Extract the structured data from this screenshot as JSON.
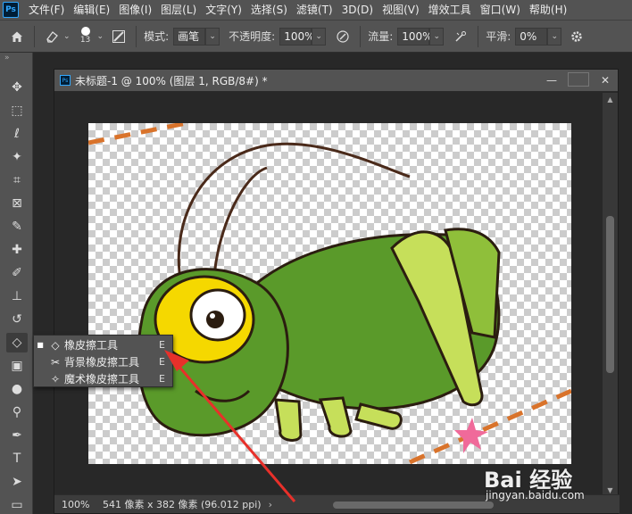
{
  "menubar": {
    "logo": "Ps",
    "items": [
      "文件(F)",
      "编辑(E)",
      "图像(I)",
      "图层(L)",
      "文字(Y)",
      "选择(S)",
      "滤镜(T)",
      "3D(D)",
      "视图(V)",
      "增效工具",
      "窗口(W)",
      "帮助(H)"
    ]
  },
  "options": {
    "brush_size": "13",
    "mode_label": "模式:",
    "mode_value": "画笔",
    "opacity_label": "不透明度:",
    "opacity_value": "100%",
    "flow_label": "流量:",
    "flow_value": "100%",
    "smooth_label": "平滑:",
    "smooth_value": "0%"
  },
  "toolbar": {
    "collapse": "»",
    "tools": [
      {
        "name": "move-tool",
        "glyph": "✥"
      },
      {
        "name": "marquee-tool",
        "glyph": "⬚"
      },
      {
        "name": "lasso-tool",
        "glyph": "ℓ"
      },
      {
        "name": "magic-wand-tool",
        "glyph": "✦"
      },
      {
        "name": "crop-tool",
        "glyph": "⌗"
      },
      {
        "name": "frame-tool",
        "glyph": "⊠"
      },
      {
        "name": "eyedropper-tool",
        "glyph": "✎"
      },
      {
        "name": "healing-brush-tool",
        "glyph": "✚"
      },
      {
        "name": "brush-tool",
        "glyph": "✐"
      },
      {
        "name": "clone-stamp-tool",
        "glyph": "⊥"
      },
      {
        "name": "history-brush-tool",
        "glyph": "↺"
      },
      {
        "name": "eraser-tool",
        "glyph": "◇"
      },
      {
        "name": "gradient-tool",
        "glyph": "▣"
      },
      {
        "name": "blur-tool",
        "glyph": "●"
      },
      {
        "name": "dodge-tool",
        "glyph": "⚲"
      },
      {
        "name": "pen-tool",
        "glyph": "✒"
      },
      {
        "name": "type-tool",
        "glyph": "T"
      },
      {
        "name": "path-selection-tool",
        "glyph": "➤"
      },
      {
        "name": "rectangle-tool",
        "glyph": "▭"
      }
    ]
  },
  "document": {
    "title": "未标题-1 @ 100% (图层 1, RGB/8#) *",
    "zoom": "100%",
    "info": "541 像素 x 382 像素 (96.012 ppi)",
    "status_arrow": "›"
  },
  "flyout": {
    "items": [
      {
        "label": "橡皮擦工具",
        "key": "E",
        "selected": true
      },
      {
        "label": "背景橡皮擦工具",
        "key": "E",
        "selected": false
      },
      {
        "label": "魔术橡皮擦工具",
        "key": "E",
        "selected": false
      }
    ]
  },
  "watermark": {
    "logo": "Bai 经验",
    "url": "jingyan.baidu.com"
  },
  "colors": {
    "annotation_arrow": "#e8302a",
    "ps_blue": "#31a8ff"
  }
}
